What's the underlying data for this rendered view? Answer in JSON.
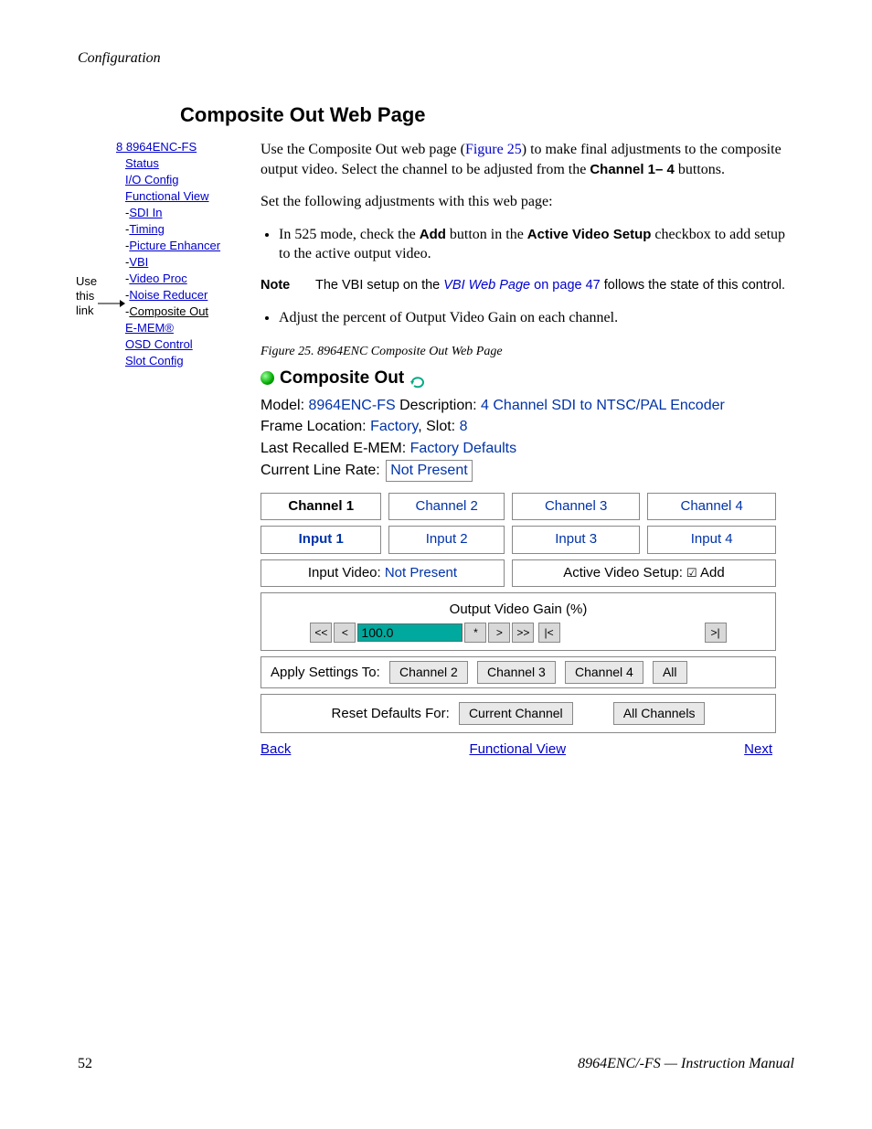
{
  "header": {
    "section": "Configuration"
  },
  "title": "Composite Out Web Page",
  "sidebar": {
    "use_label_1": "Use",
    "use_label_2": "this",
    "use_label_3": "link",
    "root": "8 8964ENC-FS",
    "items": [
      {
        "label": "Status",
        "dashed": false
      },
      {
        "label": "I/O Config",
        "dashed": false
      },
      {
        "label": "Functional View",
        "dashed": false
      },
      {
        "label": "SDI In",
        "dashed": true
      },
      {
        "label": "Timing",
        "dashed": true
      },
      {
        "label": "Picture Enhancer",
        "dashed": true
      },
      {
        "label": "VBI",
        "dashed": true
      },
      {
        "label": "Video Proc",
        "dashed": true
      },
      {
        "label": "Noise Reducer",
        "dashed": true
      },
      {
        "label": "Composite Out",
        "dashed": true,
        "current": true
      },
      {
        "label": "E-MEM®",
        "dashed": false
      },
      {
        "label": "OSD Control",
        "dashed": false
      },
      {
        "label": "Slot Config",
        "dashed": false
      }
    ]
  },
  "body": {
    "p1a": "Use the Composite Out web page (",
    "p1_fig": "Figure 25",
    "p1b": ") to make final adjustments to the composite output video. Select the channel to be adjusted from the ",
    "p1_bold": "Channel 1– 4",
    "p1c": " buttons.",
    "p2": "Set the following adjustments with this web page:",
    "b1a": "In 525 mode, check the ",
    "b1_bold1": "Add",
    "b1b": " button in the ",
    "b1_bold2": "Active Video Setup",
    "b1c": " checkbox to add setup to the active output video.",
    "note_label": "Note",
    "note_a": "The VBI setup on the ",
    "note_link": "VBI Web Page",
    "note_b": " on page 47",
    "note_c": " follows the state of this control.",
    "b2": "Adjust the percent of Output Video Gain on each channel.",
    "fig_caption": "Figure 25.  8964ENC Composite Out Web Page"
  },
  "webshot": {
    "title": "Composite Out",
    "model_label": "Model:",
    "model_val": "8964ENC-FS",
    "desc_label": "Description:",
    "desc_val": "4 Channel SDI to NTSC/PAL Encoder",
    "frame_label": "Frame Location:",
    "frame_val": "Factory",
    "slot_label": ", Slot:",
    "slot_val": "8",
    "emem_label": "Last Recalled E-MEM:",
    "emem_val": "Factory Defaults",
    "rate_label": "Current Line Rate:",
    "rate_val": "Not Present",
    "channels": [
      "Channel 1",
      "Channel 2",
      "Channel 3",
      "Channel 4"
    ],
    "inputs": [
      "Input 1",
      "Input 2",
      "Input 3",
      "Input 4"
    ],
    "input_video_label": "Input Video:",
    "input_video_val": "Not Present",
    "avs_label": "Active Video Setup: ",
    "avs_add": "Add",
    "gain_label": "Output Video Gain (%)",
    "gain_value": "100.0",
    "apply_label": "Apply Settings To:",
    "apply_buttons": [
      "Channel 2",
      "Channel 3",
      "Channel 4",
      "All"
    ],
    "reset_label": "Reset Defaults For:",
    "reset_buttons": [
      "Current Channel",
      "All Channels"
    ],
    "back": "Back",
    "fv": "Functional View",
    "next": "Next"
  },
  "footer": {
    "page": "52",
    "doc": "8964ENC/-FS — Instruction Manual"
  }
}
